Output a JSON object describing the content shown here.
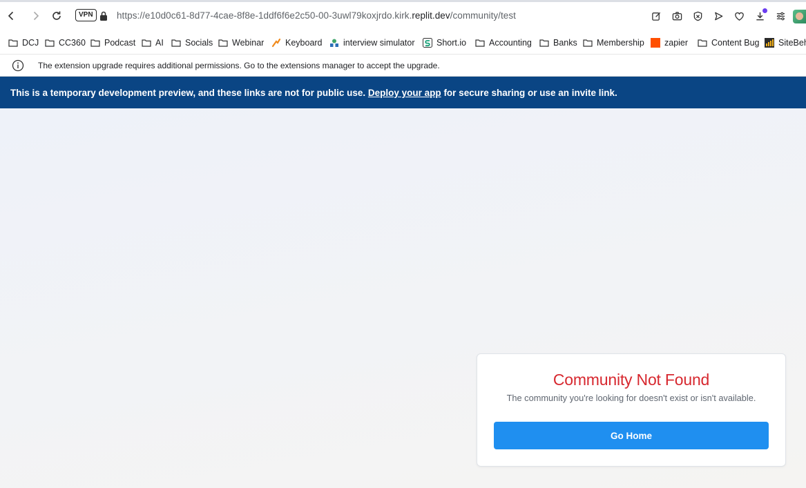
{
  "browser": {
    "vpn_label": "VPN",
    "url_prefix": "https://e10d0c61-8d77-4cae-8f8e-1ddf6f6e2c50-00-3uwl79koxjrdo.kirk.",
    "url_host": "replit.dev",
    "url_path": "/community/test",
    "icons": [
      "back-icon",
      "forward-icon",
      "reload-icon",
      "lock-icon",
      "edit-icon",
      "camera-icon",
      "shield-icon",
      "send-icon",
      "heart-icon",
      "download-icon",
      "menu-icon"
    ]
  },
  "bookmarks": [
    {
      "label": "DCJ",
      "icon": "folder"
    },
    {
      "label": "CC360",
      "icon": "folder"
    },
    {
      "label": "Podcast",
      "icon": "folder"
    },
    {
      "label": "AI",
      "icon": "folder"
    },
    {
      "label": "Socials",
      "icon": "folder"
    },
    {
      "label": "Webinar",
      "icon": "folder"
    },
    {
      "label": "Keyboard",
      "icon": "keyboard"
    },
    {
      "label": "interview simulator",
      "icon": "simulator"
    },
    {
      "label": "Short.io",
      "icon": "shortio"
    },
    {
      "label": "Accounting",
      "icon": "folder"
    },
    {
      "label": "Banks",
      "icon": "folder"
    },
    {
      "label": "Membership",
      "icon": "folder"
    },
    {
      "label": "zapier",
      "icon": "zapier"
    },
    {
      "label": "Content Bug",
      "icon": "folder"
    },
    {
      "label": "SiteBeh",
      "icon": "sitebehaviour"
    }
  ],
  "infobar": {
    "message": "The extension upgrade requires additional permissions. Go to the extensions manager to accept the upgrade."
  },
  "banner": {
    "text_before": "This is a temporary development preview, and these links are not for public use.",
    "link_text": "Deploy your app",
    "text_after": "for secure sharing or use an invite link."
  },
  "error_card": {
    "title": "Community Not Found",
    "message": "The community you're looking for doesn't exist or isn't available.",
    "button_label": "Go Home"
  },
  "colors": {
    "banner_bg": "#0a4584",
    "error_title": "#d7282f",
    "button_bg": "#1f8ff0",
    "download_badge": "#6b3df0"
  }
}
